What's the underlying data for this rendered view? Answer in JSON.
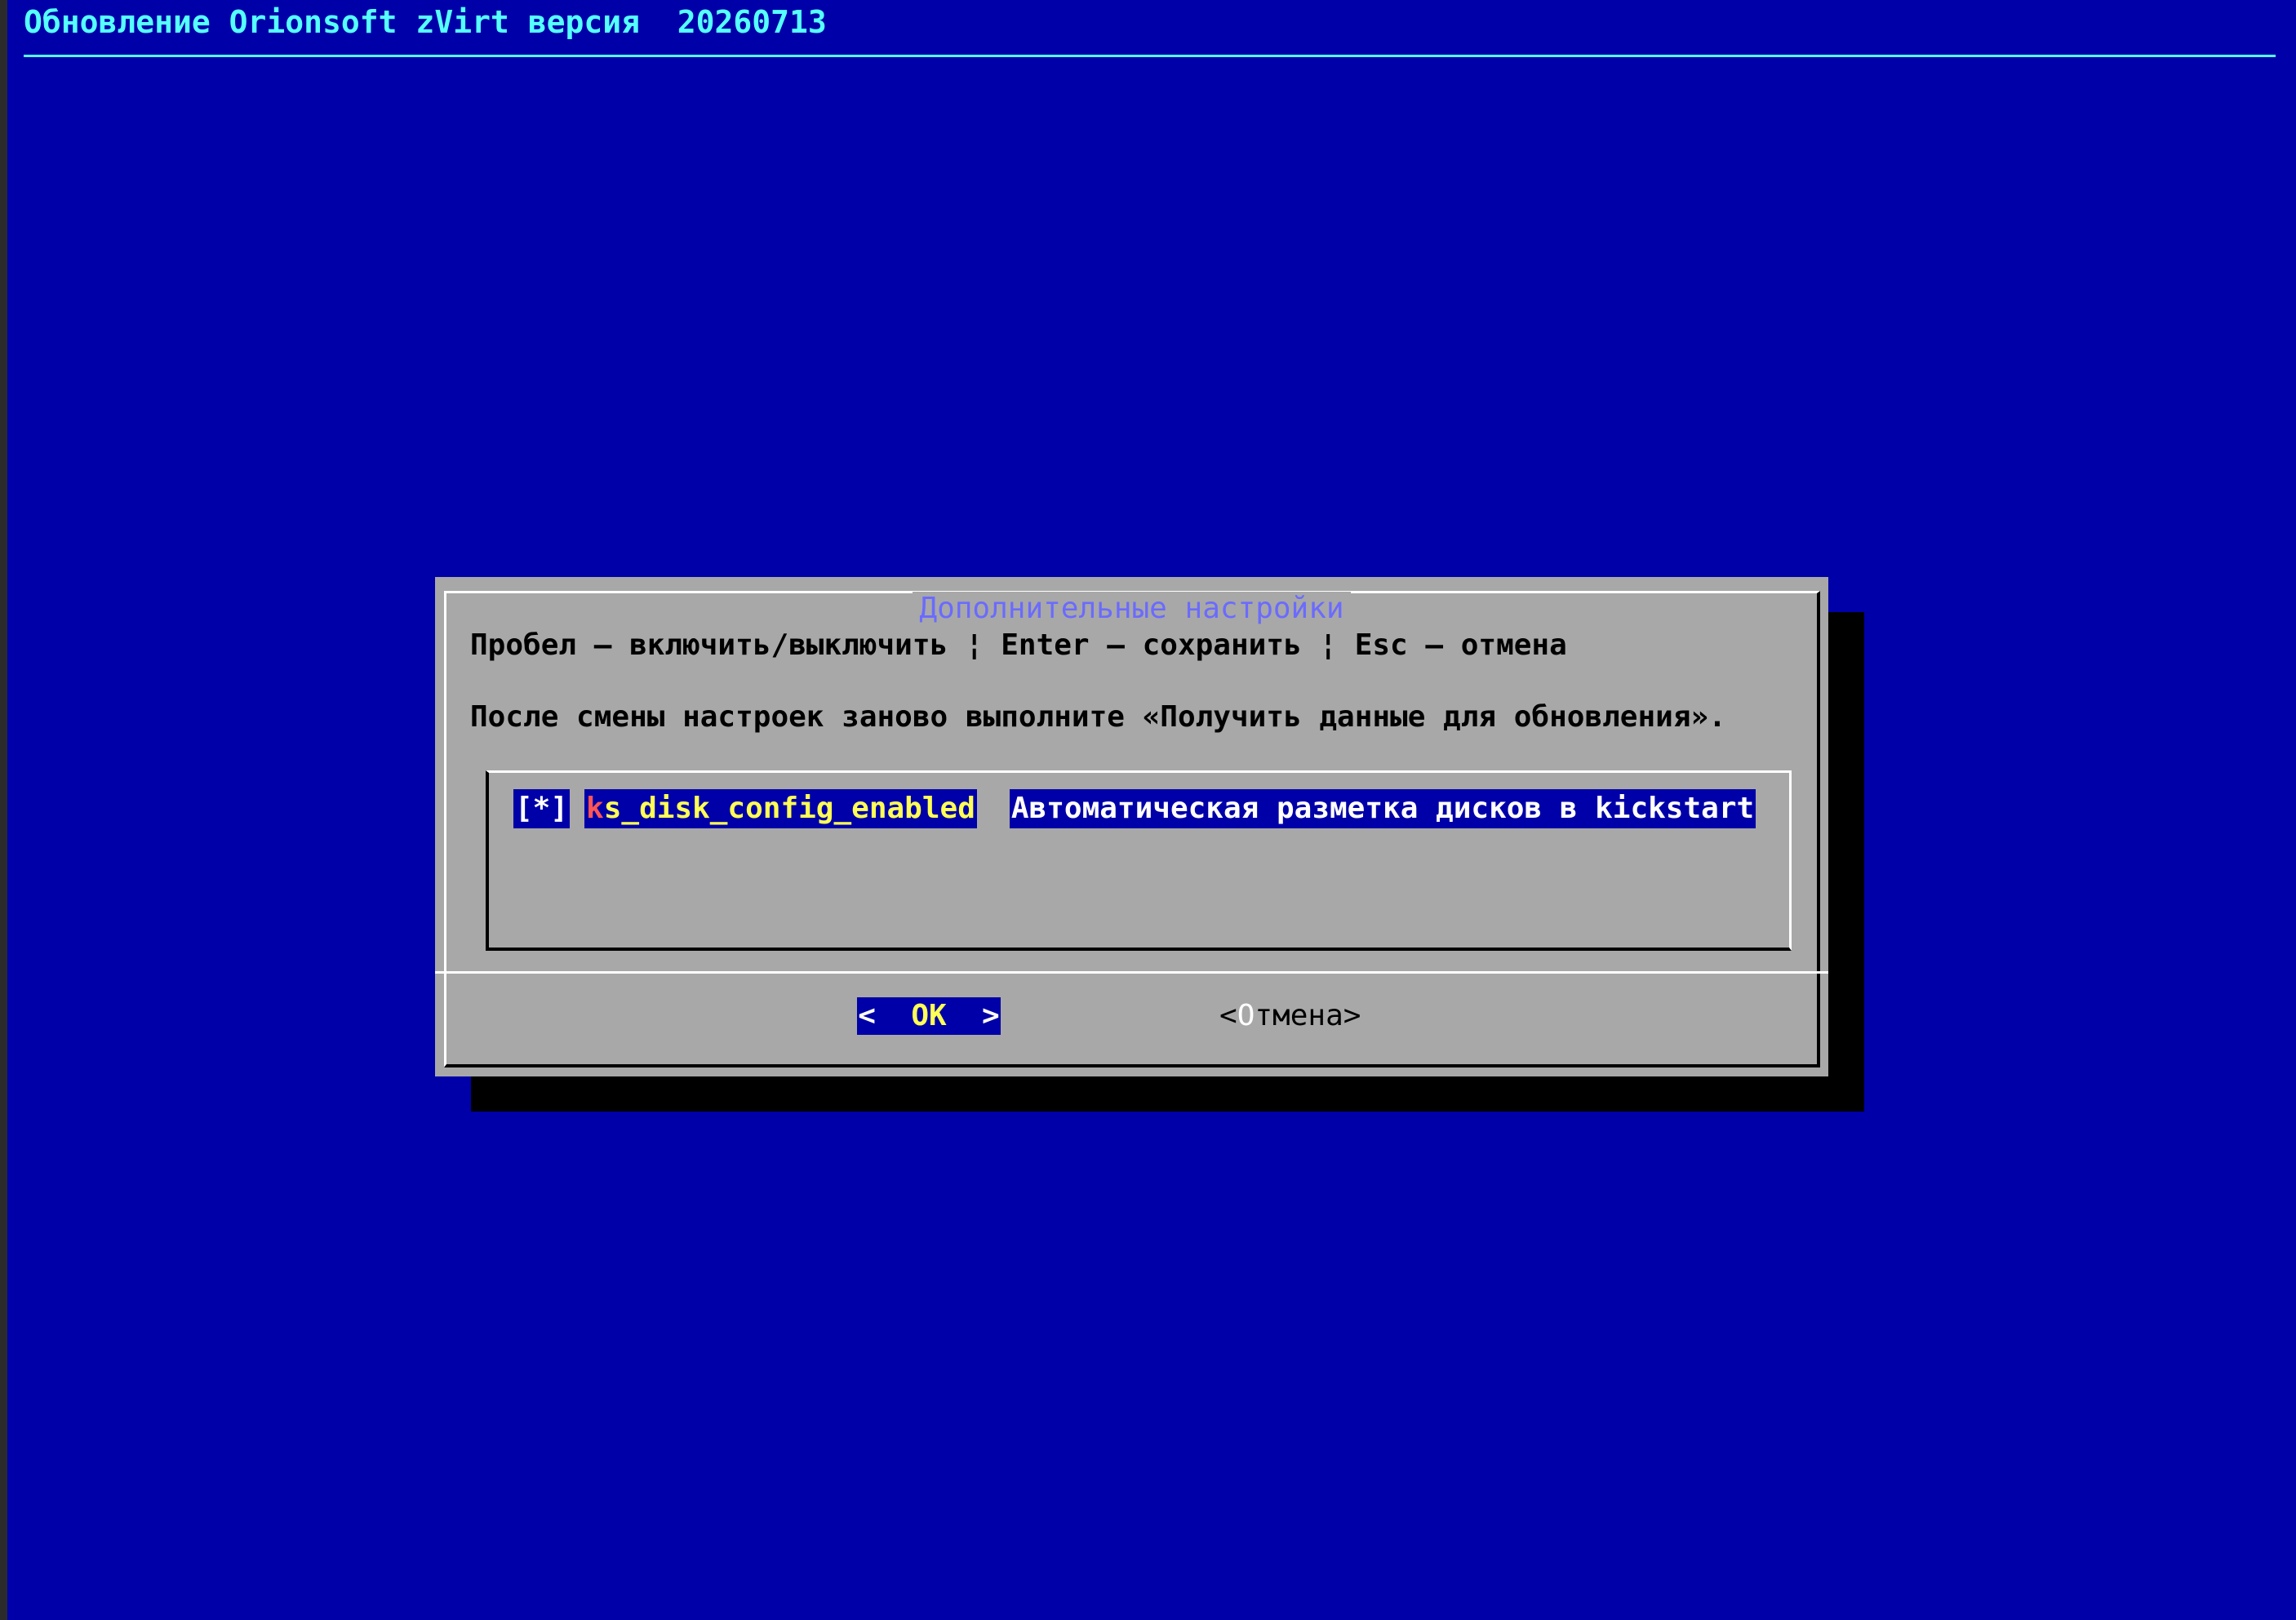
{
  "backtitle": "Обновление Orionsoft zVirt версия  20260713",
  "dialog": {
    "title": "Дополнительные настройки",
    "help_line": "Пробел — включить/выключить ¦ Enter — сохранить ¦ Esc — отмена",
    "note_line": "После смены настроек заново выполните «Получить данные для обновления».",
    "items": [
      {
        "checkbox": "[*]",
        "tag_first_letter": "k",
        "tag_rest": "s_disk_config_enabled",
        "description": "Автоматическая разметка дисков в kickstart"
      }
    ],
    "buttons": {
      "ok_left": "<",
      "ok_label": "OK",
      "ok_right": ">",
      "cancel_left": "<",
      "cancel_hotkey": "О",
      "cancel_rest": "тмена",
      "cancel_right": ">"
    }
  },
  "colors": {
    "screen_background": "#0000a8",
    "dialog_background": "#a8a8a8",
    "backtitle_text": "#55ffff",
    "title_text": "#6b6bff",
    "selected_tag_text": "#ffff55",
    "hotkey_text": "#ff5555"
  }
}
